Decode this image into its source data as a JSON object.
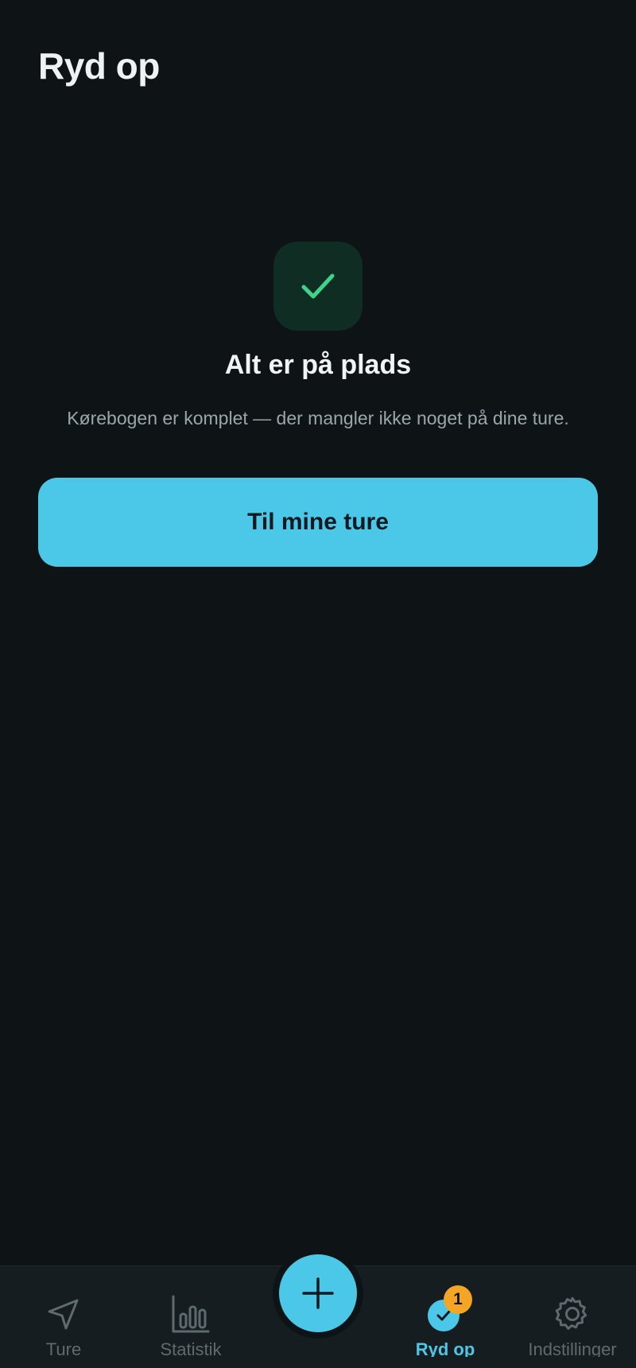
{
  "header": {
    "title": "Ryd op"
  },
  "empty_state": {
    "icon": "checkmark-icon",
    "title": "Alt er på plads",
    "subtitle": "Kørebogen er komplet — der mangler ikke noget på dine ture.",
    "cta_label": "Til mine ture"
  },
  "tabbar": {
    "items": [
      {
        "label": "Ture",
        "icon": "navigation-arrow-icon"
      },
      {
        "label": "Statistik",
        "icon": "bar-chart-icon"
      },
      {
        "label": "Ryd op",
        "icon": "check-circle-icon",
        "badge": "1",
        "active": true
      },
      {
        "label": "Indstillinger",
        "icon": "gear-icon"
      }
    ],
    "fab_icon": "plus-icon"
  },
  "colors": {
    "background": "#0e1316",
    "accent": "#4bc8e8",
    "success": "#3fd28a",
    "badge": "#f5a524"
  }
}
